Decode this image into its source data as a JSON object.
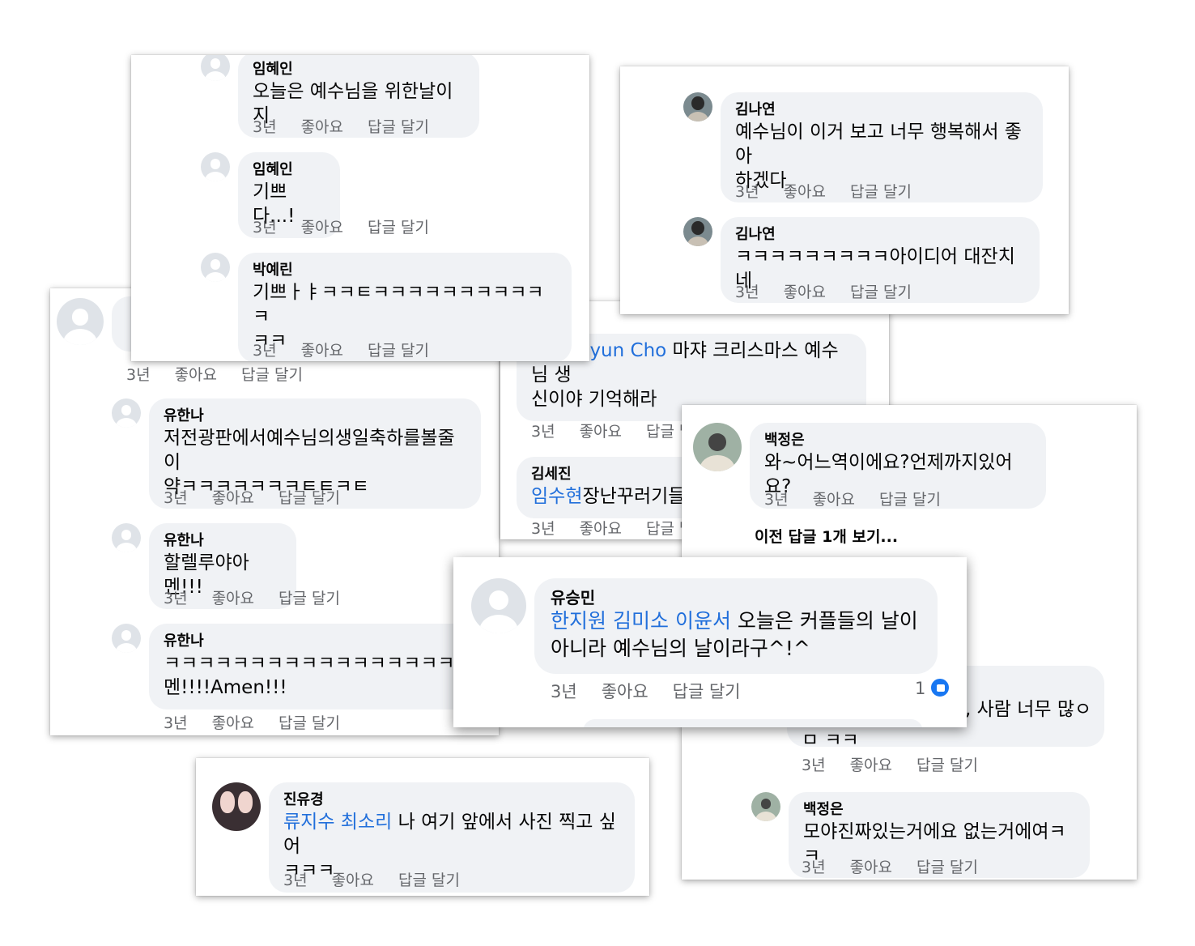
{
  "meta_labels": {
    "time": "3년",
    "like": "좋아요",
    "reply": "답글 달기"
  },
  "card_a": {
    "comments": [
      {
        "name": "임혜인",
        "text": "오늘은 예수님을 위한날이지"
      },
      {
        "name": "임혜인",
        "text": "기쁘다...!"
      },
      {
        "name": "박예린",
        "text": "기쁘ㅏㅑㅋㅋㅌㅋㅋㅋㅋㅋㅋㅋㅋㅋㅋㅋ\nㅋㅋ"
      }
    ]
  },
  "card_b": {
    "comments": [
      {
        "name": "김나연",
        "text": "예수님이 이거 보고 너무 행복해서 좋아\n하겠다"
      },
      {
        "name": "김나연",
        "text": "ㅋㅋㅋㅋㅋㅋㅋㅋㅋ아이디어 대잔치네"
      }
    ]
  },
  "card_c": {
    "comments": [
      {
        "name": "유한나",
        "text": "저전광판에서예수님의생일축하를볼줄이\n약ㅋㅋㅋㅋㅋㅋㅋㅌㅌㅋㅌ"
      },
      {
        "name": "유한나",
        "text": "할렐루야아멘!!!"
      },
      {
        "name": "유한나",
        "text": "ㅋㅋㅋㅋㅋㅋㅋㅋㅋㅋㅋㅋㅋㅋㅋㅋㅋㅋ아\n멘!!!!Amen!!!"
      }
    ]
  },
  "card_d": {
    "first_mention": "Sanghyun Cho",
    "first_text": " 마쟈 크리스마스 예수님 생\n신이야 기억해라",
    "second_name": "김세진",
    "second_mention": "임수현",
    "second_text": "장난꾸러기들"
  },
  "card_e": {
    "comment": {
      "name": "백정은",
      "text": "와~어느역이에요?언제까지있어요?"
    },
    "view_more": "이전 답글 1개 보기...",
    "partial_text": ", 사람 너무 많ㅇ",
    "partial_text2": "ㅁ ㅋㅋ",
    "comment2": {
      "name": "백정은",
      "text": "모야진짜있는거에요 없는거에여ㅋㅋ"
    }
  },
  "card_f": {
    "name": "유승민",
    "mentions": [
      "한지원",
      "김미소",
      "이윤서"
    ],
    "text_line1": " 오늘은 커플들의 날이",
    "text_line2": "아니라 예수님의 날이라구^!^",
    "like_count": "1"
  },
  "card_g": {
    "name": "진유경",
    "mentions": [
      "류지수",
      "최소리"
    ],
    "text_line1": " 나 여기 앞에서 사진 찍고 싶어",
    "text_line2": "ㅋㅋㅋ"
  },
  "colors": {
    "mention": "#216fdb",
    "bubble": "#f0f2f5",
    "meta": "#65676b",
    "like": "#1877f2"
  }
}
